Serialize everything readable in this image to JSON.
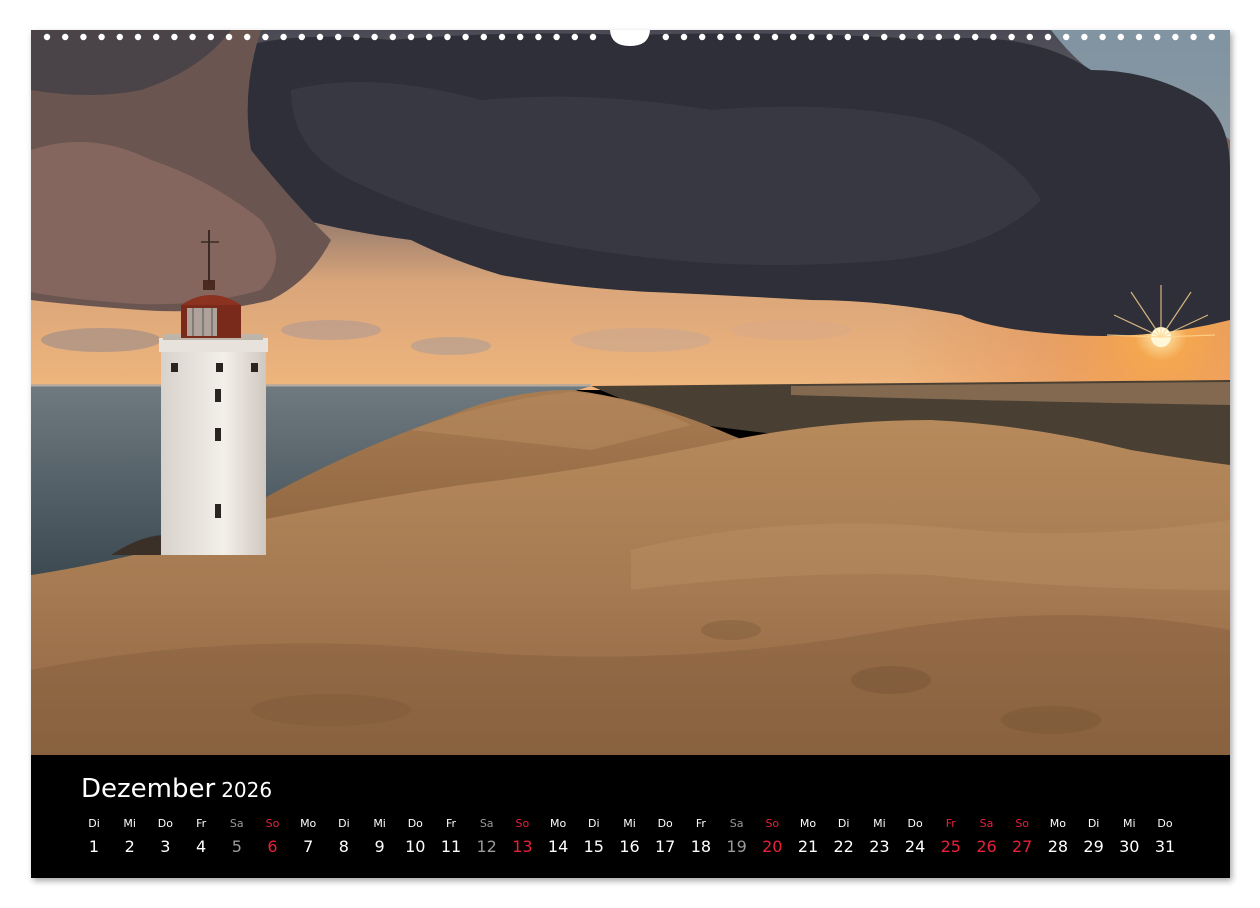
{
  "calendar": {
    "month": "Dezember",
    "year": "2026"
  },
  "days": [
    {
      "wd": "Di",
      "n": "1",
      "red": false
    },
    {
      "wd": "Mi",
      "n": "2",
      "red": false
    },
    {
      "wd": "Do",
      "n": "3",
      "red": false
    },
    {
      "wd": "Fr",
      "n": "4",
      "red": false
    },
    {
      "wd": "Sa",
      "n": "5",
      "red": false,
      "dim": true
    },
    {
      "wd": "So",
      "n": "6",
      "red": true
    },
    {
      "wd": "Mo",
      "n": "7",
      "red": false
    },
    {
      "wd": "Di",
      "n": "8",
      "red": false
    },
    {
      "wd": "Mi",
      "n": "9",
      "red": false
    },
    {
      "wd": "Do",
      "n": "10",
      "red": false
    },
    {
      "wd": "Fr",
      "n": "11",
      "red": false
    },
    {
      "wd": "Sa",
      "n": "12",
      "red": false,
      "dim": true
    },
    {
      "wd": "So",
      "n": "13",
      "red": true
    },
    {
      "wd": "Mo",
      "n": "14",
      "red": false
    },
    {
      "wd": "Di",
      "n": "15",
      "red": false
    },
    {
      "wd": "Mi",
      "n": "16",
      "red": false
    },
    {
      "wd": "Do",
      "n": "17",
      "red": false
    },
    {
      "wd": "Fr",
      "n": "18",
      "red": false
    },
    {
      "wd": "Sa",
      "n": "19",
      "red": false,
      "dim": true
    },
    {
      "wd": "So",
      "n": "20",
      "red": true
    },
    {
      "wd": "Mo",
      "n": "21",
      "red": false
    },
    {
      "wd": "Di",
      "n": "22",
      "red": false
    },
    {
      "wd": "Mi",
      "n": "23",
      "red": false
    },
    {
      "wd": "Do",
      "n": "24",
      "red": false
    },
    {
      "wd": "Fr",
      "n": "25",
      "red": true
    },
    {
      "wd": "Sa",
      "n": "26",
      "red": true
    },
    {
      "wd": "So",
      "n": "27",
      "red": true
    },
    {
      "wd": "Mo",
      "n": "28",
      "red": false
    },
    {
      "wd": "Di",
      "n": "29",
      "red": false
    },
    {
      "wd": "Mi",
      "n": "30",
      "red": false
    },
    {
      "wd": "Do",
      "n": "31",
      "red": false
    }
  ],
  "colors": {
    "holiday_red": "#e8203a",
    "bar_background": "#000000"
  }
}
